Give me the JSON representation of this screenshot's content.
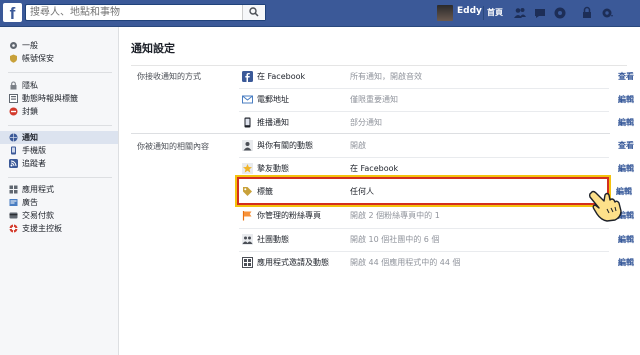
{
  "header": {
    "logo": "f",
    "search_placeholder": "搜尋人、地點和事物",
    "user_name": "Eddy",
    "home_label": "首頁",
    "icons": [
      "friends-icon",
      "messages-icon",
      "notifications-icon",
      "privacy-lock-icon",
      "settings-gear-icon"
    ]
  },
  "sidebar": {
    "groups": [
      {
        "items": [
          {
            "label": "一般",
            "icon": "gear-icon"
          },
          {
            "label": "帳號保安",
            "icon": "shield-icon"
          }
        ]
      },
      {
        "items": [
          {
            "label": "隱私",
            "icon": "lock-icon"
          },
          {
            "label": "動態時報與標籤",
            "icon": "timeline-icon"
          },
          {
            "label": "封鎖",
            "icon": "block-icon"
          }
        ]
      },
      {
        "items": [
          {
            "label": "通知",
            "icon": "globe-icon",
            "active": true
          },
          {
            "label": "手機版",
            "icon": "mobile-icon"
          },
          {
            "label": "追蹤者",
            "icon": "rss-icon"
          }
        ]
      },
      {
        "items": [
          {
            "label": "應用程式",
            "icon": "apps-icon"
          },
          {
            "label": "廣告",
            "icon": "ads-icon"
          },
          {
            "label": "交易付款",
            "icon": "payments-icon"
          },
          {
            "label": "支援主控板",
            "icon": "support-icon"
          }
        ]
      }
    ]
  },
  "main": {
    "title": "通知設定",
    "sections": [
      {
        "label": "你接收通知的方式",
        "rows": [
          {
            "label": "在 Facebook",
            "value": "所有通知，開啟音效",
            "action": "查看",
            "icon": "facebook-icon"
          },
          {
            "label": "電郵地址",
            "value": "僅限重要通知",
            "action": "編輯",
            "icon": "email-icon"
          },
          {
            "label": "推播通知",
            "value": "部分通知",
            "action": "編輯",
            "icon": "phone-icon"
          }
        ]
      },
      {
        "label": "你被通知的相關內容",
        "rows": [
          {
            "label": "與你有關的動態",
            "value": "開啟",
            "action": "查看",
            "icon": "person-icon"
          },
          {
            "label": "摯友動態",
            "value": "在 Facebook",
            "action": "編輯",
            "icon": "star-icon"
          },
          {
            "label": "標籤",
            "value": "任何人",
            "action": "編輯",
            "icon": "tag-icon",
            "highlighted": true
          },
          {
            "label": "你管理的粉絲專頁",
            "value": "開啟 2 個粉絲專頁中的 1",
            "action": "編輯",
            "icon": "flag-icon"
          },
          {
            "label": "社團動態",
            "value": "開啟 10 個社團中的 6 個",
            "action": "編輯",
            "icon": "group-icon"
          },
          {
            "label": "應用程式邀請及動態",
            "value": "開啟 44 個應用程式中的 44 個",
            "action": "編輯",
            "icon": "app-icon"
          }
        ]
      }
    ]
  },
  "colors": {
    "brand": "#3b5998",
    "link": "#365899",
    "highlight_border": "#d32f1f",
    "highlight_outline": "#f4c20d"
  }
}
